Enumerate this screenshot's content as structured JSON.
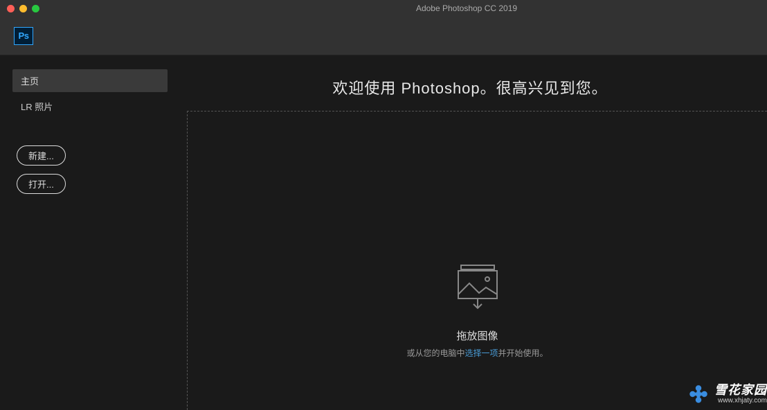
{
  "titlebar": {
    "title": "Adobe Photoshop CC 2019"
  },
  "logo": {
    "text": "Ps"
  },
  "sidebar": {
    "nav": {
      "home": "主页",
      "lr_photos": "LR 照片"
    },
    "buttons": {
      "new": "新建...",
      "open": "打开..."
    }
  },
  "main": {
    "welcome": "欢迎使用 Photoshop。很高兴见到您。",
    "drop": {
      "title": "拖放图像",
      "sub_prefix": "或从您的电脑中",
      "sub_link": "选择一项",
      "sub_suffix": "并开始使用。"
    }
  },
  "watermark": {
    "name": "雪花家园",
    "url": "www.xhjaty.com"
  }
}
